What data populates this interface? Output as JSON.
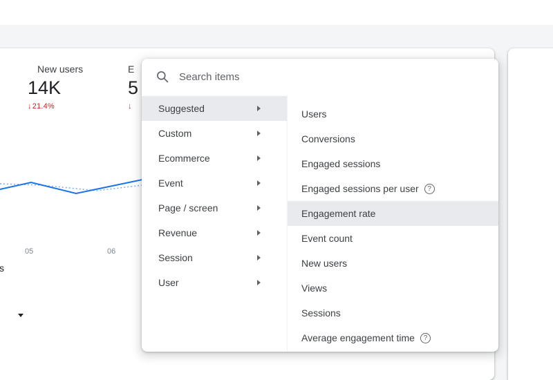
{
  "colors": {
    "accent_blue": "#1a73e8",
    "negative_red": "#c5221f",
    "highlight_gray": "#e8eaed",
    "background_gray": "#f3f5f6"
  },
  "metrics": [
    {
      "label": "New users",
      "value": "14K",
      "arrow": "↓",
      "change": "21.4%"
    },
    {
      "label": "E",
      "value": "5",
      "arrow": "↓"
    }
  ],
  "chart": {
    "type": "line",
    "x_ticks": [
      "05",
      "06"
    ]
  },
  "fragments": {
    "legend_text": "s"
  },
  "popup": {
    "search_placeholder": "Search items",
    "help_glyph": "?",
    "categories": [
      {
        "label": "Suggested",
        "selected": true
      },
      {
        "label": "Custom"
      },
      {
        "label": "Ecommerce"
      },
      {
        "label": "Event"
      },
      {
        "label": "Page / screen"
      },
      {
        "label": "Revenue"
      },
      {
        "label": "Session"
      },
      {
        "label": "User"
      }
    ],
    "items": [
      {
        "label": "Users"
      },
      {
        "label": "Conversions"
      },
      {
        "label": "Engaged sessions"
      },
      {
        "label": "Engaged sessions per user",
        "help": true
      },
      {
        "label": "Engagement rate",
        "highlighted": true
      },
      {
        "label": "Event count"
      },
      {
        "label": "New users"
      },
      {
        "label": "Views"
      },
      {
        "label": "Sessions"
      },
      {
        "label": "Average engagement time",
        "help": true
      }
    ]
  }
}
